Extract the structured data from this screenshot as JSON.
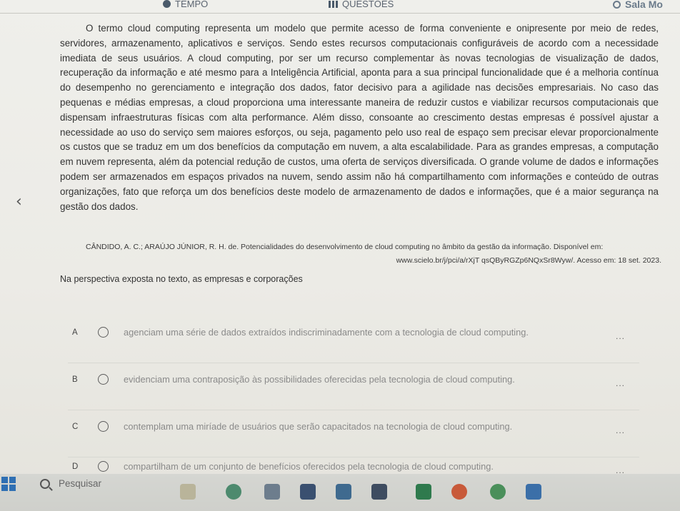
{
  "topbar": {
    "time_label": "TEMPO",
    "questions_label": "QUESTÕES",
    "room_label": "Sala Mo"
  },
  "passage": {
    "paragraph": "O termo cloud computing representa um modelo que permite acesso de forma conveniente e onipresente por meio de redes, servidores, armazenamento, aplicativos e serviços. Sendo estes recursos computacionais configuráveis de acordo com a necessidade imediata de seus usuários. A cloud computing, por ser um recurso complementar às novas tecnologias de visualização de dados, recuperação da informação e até mesmo para a Inteligência Artificial, aponta para a sua principal funcionalidade que é a melhoria contínua do desempenho no gerenciamento e integração dos dados, fator decisivo para a agilidade nas decisões empresariais. No caso das pequenas e médias empresas, a cloud proporciona uma interessante maneira de reduzir custos e viabilizar recursos computacionais que dispensam infraestruturas físicas com alta performance. Além disso, consoante ao crescimento destas empresas é possível ajustar a necessidade ao uso do serviço sem maiores esforços, ou seja, pagamento pelo uso real de espaço sem precisar elevar proporcionalmente os custos que se traduz em um dos benefícios da computação em nuvem, a alta escalabilidade. Para as grandes empresas, a computação em nuvem representa, além da potencial redução de custos, uma oferta de serviços diversificada. O grande volume de dados e informações podem ser armazenados em espaços privados na nuvem, sendo assim não há compartilhamento com informações e conteúdo de outras organizações, fato que reforça um dos benefícios deste modelo de armazenamento de dados e informações, que é a maior segurança na gestão dos dados."
  },
  "citation": {
    "line1": "CÂNDIDO, A. C.; ARAÚJO JÚNIOR, R. H. de. Potencialidades do desenvolvimento de cloud computing no âmbito da gestão da informação. Disponível em:",
    "line2": "www.scielo.br/j/pci/a/rXjT qsQByRGZp6NQxSr8Wyw/. Acesso em: 18 set. 2023."
  },
  "question": {
    "prompt": "Na perspectiva exposta no texto, as empresas e corporações"
  },
  "options": [
    {
      "letter": "A",
      "text": "agenciam uma série de dados extraídos indiscriminadamente com a tecnologia de cloud computing.",
      "more": "..."
    },
    {
      "letter": "B",
      "text": "evidenciam uma contraposição às possibilidades oferecidas pela tecnologia de cloud computing.",
      "more": "..."
    },
    {
      "letter": "C",
      "text": "contemplam uma miríade de usuários que serão capacitados na tecnologia de cloud computing.",
      "more": "..."
    },
    {
      "letter": "D",
      "text": "compartilham de um conjunto de benefícios oferecidos pela tecnologia de cloud computing.",
      "more": "..."
    }
  ],
  "taskbar": {
    "search_label": "Pesquisar"
  },
  "icons": {
    "back": "chevron-left-icon",
    "search": "search-icon",
    "windows": "windows-start-icon"
  }
}
